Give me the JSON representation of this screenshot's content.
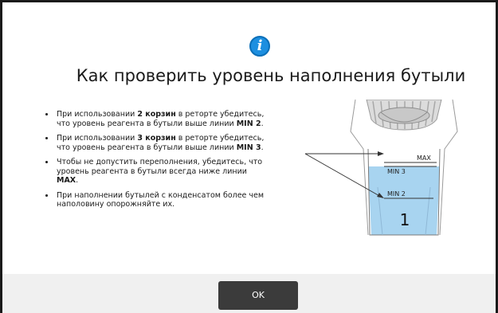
{
  "dialog": {
    "icon": "info-icon",
    "icon_glyph": "i",
    "title": "Как проверить уровень наполнения бутыли",
    "accent_color": "#1d8fe0",
    "bullets": [
      {
        "pre": "При использовании ",
        "bold": "2 корзин",
        "mid": " в реторте убедитесь, что уровень реагента в бутыли выше линии ",
        "bold2": "MIN 2",
        "post": "."
      },
      {
        "pre": "При использовании ",
        "bold": "3 корзин",
        "mid": " в реторте убедитесь, что уровень реагента в бутыли выше линии ",
        "bold2": "MIN 3",
        "post": "."
      },
      {
        "pre": "Чтобы не допустить переполнения, убедитесь, что уровень реагента в бутыли всегда ниже линии ",
        "bold": "MAX",
        "mid": "",
        "bold2": "",
        "post": "."
      },
      {
        "pre": "При наполнении бутылей с конденсатом более чем наполовину опорожняйте их.",
        "bold": "",
        "mid": "",
        "bold2": "",
        "post": ""
      }
    ],
    "bottle": {
      "max_label": "MAX",
      "min3_label": "MIN   3",
      "min2_label": "MIN   2",
      "number": "1",
      "liquid_color": "#a8d4f0"
    },
    "ok_label": "OK"
  }
}
